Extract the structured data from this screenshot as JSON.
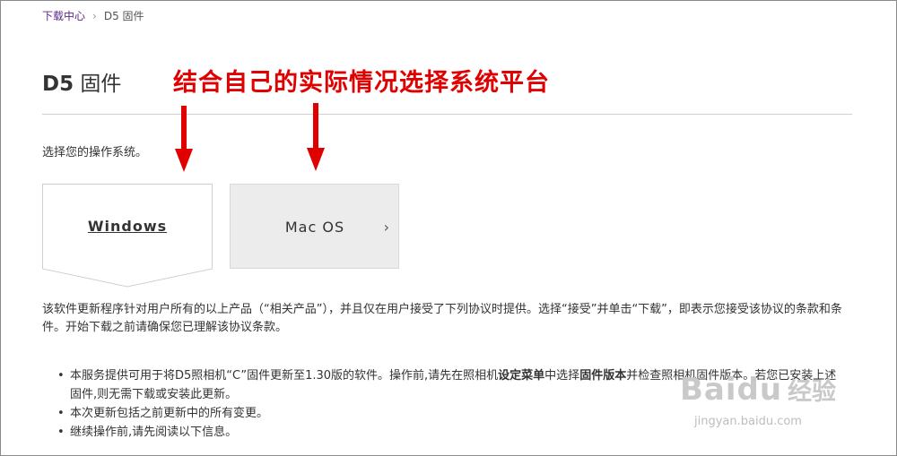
{
  "breadcrumb": {
    "home": "下载中心",
    "separator": "›",
    "current": "D5 固件"
  },
  "page": {
    "title_bold": "D5",
    "title_rest": " 固件"
  },
  "annotation": {
    "text": "结合自己的实际情况选择系统平台",
    "color": "#e00000"
  },
  "os_select": {
    "prompt": "选择您的操作系统。",
    "windows_label": "Windows",
    "mac_label": "Mac OS",
    "mac_chevron": "›"
  },
  "terms": {
    "paragraph": "该软件更新程序针对用户所有的以上产品（“相关产品”），并且仅在用户接受了下列协议时提供。选择“接受”并单击“下载”，即表示您接受该协议的条款和条件。开始下载之前请确保您已理解该协议条款。"
  },
  "bullets": {
    "b1_part1": "本服务提供可用于将D5照相机“C”固件更新至1.30版的软件。操作前,请先在照相机",
    "b1_bold1": "设定菜单",
    "b1_part2": "中选择",
    "b1_bold2": "固件版本",
    "b1_part3": "并检查照相机固件版本。若您已安装上述固件,则无需下载或安装此更新。",
    "b2": "本次更新包括之前更新中的所有变更。",
    "b3": "继续操作前,请先阅读以下信息。"
  },
  "watermark": {
    "brand": "Baidu",
    "sub": "经验",
    "url": "jingyan.baidu.com"
  }
}
